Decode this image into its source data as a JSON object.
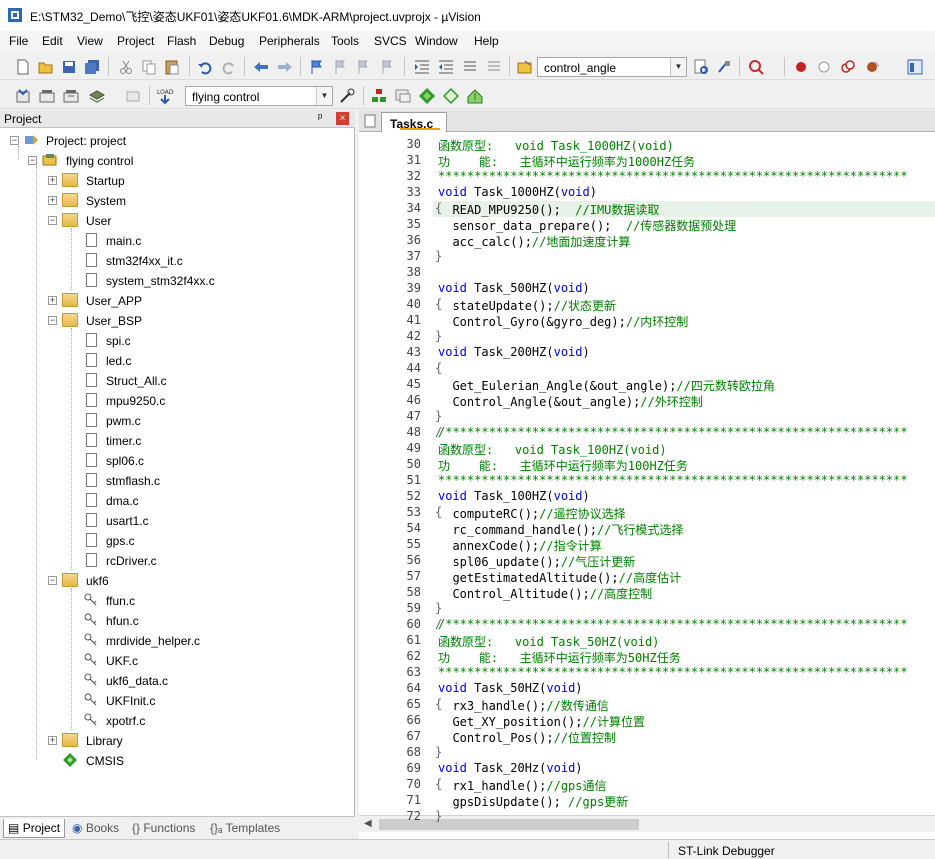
{
  "window": {
    "title": "E:\\STM32_Demo\\飞控\\姿态UKF01\\姿态UKF01.6\\MDK-ARM\\project.uvprojx - µVision"
  },
  "menu": [
    "File",
    "Edit",
    "View",
    "Project",
    "Flash",
    "Debug",
    "Peripherals",
    "Tools",
    "SVCS",
    "Window",
    "Help"
  ],
  "toolbar1": {
    "function_combo": "control_angle"
  },
  "toolbar2": {
    "target_combo": "flying control"
  },
  "project_panel": {
    "title": "Project",
    "pin": "ᵖ",
    "close": "×",
    "tree": {
      "root": "Project: project",
      "target": "flying control",
      "groups": {
        "startup": "Startup",
        "system": "System",
        "user": "User",
        "user_files": [
          "main.c",
          "stm32f4xx_it.c",
          "system_stm32f4xx.c"
        ],
        "user_app": "User_APP",
        "user_bsp": "User_BSP",
        "bsp_files": [
          "spi.c",
          "led.c",
          "Struct_All.c",
          "mpu9250.c",
          "pwm.c",
          "timer.c",
          "spl06.c",
          "stmflash.c",
          "dma.c",
          "usart1.c",
          "gps.c",
          "rcDriver.c"
        ],
        "ukf6": "ukf6",
        "ukf6_files": [
          "ffun.c",
          "hfun.c",
          "mrdivide_helper.c",
          "UKF.c",
          "ukf6_data.c",
          "UKFInit.c",
          "xpotrf.c"
        ],
        "library": "Library",
        "cmsis": "CMSIS"
      }
    },
    "bottom_tabs": [
      "Project",
      "Books",
      "{} Functions",
      "{}ₐ Templates"
    ]
  },
  "editor": {
    "tab": "Tasks.c",
    "lines": [
      {
        "n": "30",
        "t": "函数原型:   void Task_1000HZ(void)",
        "cls": "c"
      },
      {
        "n": "31",
        "t": "功    能:   主循环中运行频率为1000HZ任务",
        "cls": "c"
      },
      {
        "n": "32",
        "t": "*****************************************************************",
        "cls": "c"
      },
      {
        "n": "33",
        "t": "void Task_1000HZ(void)",
        "cls": ""
      },
      {
        "n": "34",
        "t": "  READ_MPU9250();  //IMU数据读取",
        "cls": ""
      },
      {
        "n": "35",
        "t": "  sensor_data_prepare();  //传感器数据预处理",
        "cls": ""
      },
      {
        "n": "36",
        "t": "  acc_calc();//地面加速度计算",
        "cls": ""
      },
      {
        "n": "37",
        "t": "",
        "cls": ""
      },
      {
        "n": "38",
        "t": "",
        "cls": ""
      },
      {
        "n": "39",
        "t": "void Task_500HZ(void)",
        "cls": ""
      },
      {
        "n": "40",
        "t": "  stateUpdate();//状态更新",
        "cls": ""
      },
      {
        "n": "41",
        "t": "  Control_Gyro(&gyro_deg);//内环控制",
        "cls": ""
      },
      {
        "n": "42",
        "t": "",
        "cls": ""
      },
      {
        "n": "43",
        "t": "void Task_200HZ(void)",
        "cls": ""
      },
      {
        "n": "44",
        "t": "",
        "cls": ""
      },
      {
        "n": "45",
        "t": "  Get_Eulerian_Angle(&out_angle);//四元数转欧拉角",
        "cls": ""
      },
      {
        "n": "46",
        "t": "  Control_Angle(&out_angle);//外环控制",
        "cls": ""
      },
      {
        "n": "47",
        "t": "",
        "cls": ""
      },
      {
        "n": "48",
        "t": "/****************************************************************",
        "cls": "c"
      },
      {
        "n": "49",
        "t": "函数原型:   void Task_100HZ(void)",
        "cls": "c"
      },
      {
        "n": "50",
        "t": "功    能:   主循环中运行频率为100HZ任务",
        "cls": "c"
      },
      {
        "n": "51",
        "t": "*****************************************************************",
        "cls": "c"
      },
      {
        "n": "52",
        "t": "void Task_100HZ(void)",
        "cls": ""
      },
      {
        "n": "53",
        "t": "  computeRC();//遥控协议选择",
        "cls": ""
      },
      {
        "n": "54",
        "t": "  rc_command_handle();//飞行模式选择",
        "cls": ""
      },
      {
        "n": "55",
        "t": "  annexCode();//指令计算",
        "cls": ""
      },
      {
        "n": "56",
        "t": "  spl06_update();//气压计更新",
        "cls": ""
      },
      {
        "n": "57",
        "t": "  getEstimatedAltitude();//高度估计",
        "cls": ""
      },
      {
        "n": "58",
        "t": "  Control_Altitude();//高度控制",
        "cls": ""
      },
      {
        "n": "59",
        "t": "",
        "cls": ""
      },
      {
        "n": "60",
        "t": "/****************************************************************",
        "cls": "c"
      },
      {
        "n": "61",
        "t": "函数原型:   void Task_50HZ(void)",
        "cls": "c"
      },
      {
        "n": "62",
        "t": "功    能:   主循环中运行频率为50HZ任务",
        "cls": "c"
      },
      {
        "n": "63",
        "t": "*****************************************************************",
        "cls": "c"
      },
      {
        "n": "64",
        "t": "void Task_50HZ(void)",
        "cls": ""
      },
      {
        "n": "65",
        "t": "  rx3_handle();//数传通信",
        "cls": ""
      },
      {
        "n": "66",
        "t": "  Get_XY_position();//计算位置",
        "cls": ""
      },
      {
        "n": "67",
        "t": "  Control_Pos();//位置控制",
        "cls": ""
      },
      {
        "n": "68",
        "t": "",
        "cls": ""
      },
      {
        "n": "69",
        "t": "void Task_20Hz(void)",
        "cls": ""
      },
      {
        "n": "70",
        "t": "  rx1_handle();//gps通信",
        "cls": ""
      },
      {
        "n": "71",
        "t": "  gpsDisUpdate(); //gps更新",
        "cls": ""
      },
      {
        "n": "72",
        "t": "",
        "cls": ""
      }
    ],
    "fold_marks": {
      "34": "{",
      "37": "}",
      "40": "{",
      "42": "}",
      "44": "{",
      "47": "}",
      "48": "/",
      "53": "{",
      "59": "}",
      "60": "/",
      "65": "{",
      "68": "}",
      "70": "{",
      "72": "}"
    }
  },
  "status": {
    "debugger": "ST-Link Debugger"
  }
}
